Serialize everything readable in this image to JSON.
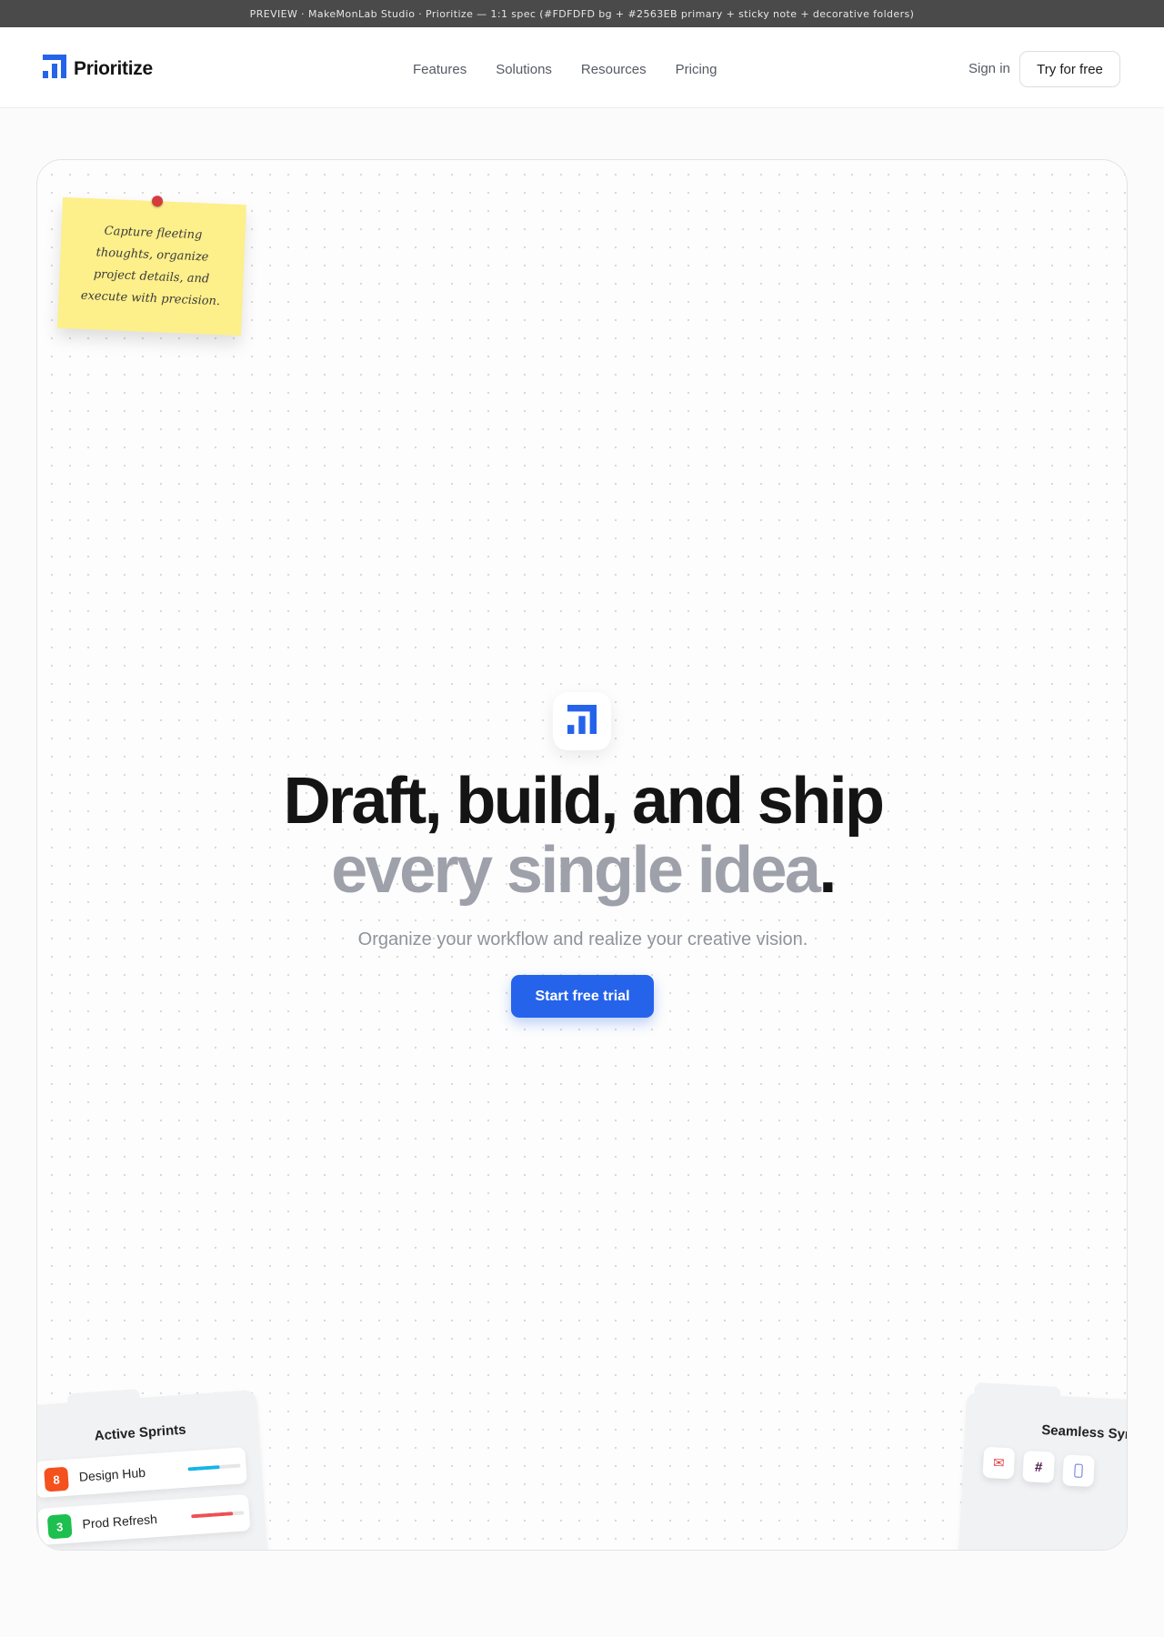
{
  "preview": {
    "text": "PREVIEW · MakeMonLab Studio · Prioritize — 1:1 spec (#FDFDFD bg + #2563EB primary + sticky note + decorative folders)"
  },
  "brand": {
    "name": "Prioritize",
    "icon": "logo-mark-icon",
    "color": "#2563EB"
  },
  "nav": {
    "links": [
      "Features",
      "Solutions",
      "Resources",
      "Pricing"
    ],
    "sign_in": "Sign in",
    "cta": "Try for free"
  },
  "sticky_note": {
    "text": "Capture fleeting thoughts, organize project details, and execute with precision.",
    "color": "#FDEF8A"
  },
  "hero": {
    "headline_line1": "Draft, build, and ship",
    "headline_line2": "every single idea",
    "headline_punct": ".",
    "subheadline": "Organize your workflow and realize your creative vision.",
    "cta": "Start free trial"
  },
  "folders": {
    "sprints": {
      "title": "Active Sprints",
      "items": [
        {
          "count": "8",
          "name": "Design Hub",
          "badge_color": "#F4511E",
          "bar_color": "#16B5E8",
          "progress": 0.6
        },
        {
          "count": "3",
          "name": "Prod Refresh",
          "badge_color": "#1DBF4E",
          "bar_color": "#EF4F55",
          "progress": 0.8
        }
      ]
    },
    "sync": {
      "title": "Seamless Sync",
      "icons": [
        "mail-icon",
        "slack-hash-icon",
        "phone-icon"
      ]
    }
  },
  "colors": {
    "background": "#FDFDFD",
    "primary": "#2563EB",
    "muted_headline": "#9EA0AA"
  }
}
